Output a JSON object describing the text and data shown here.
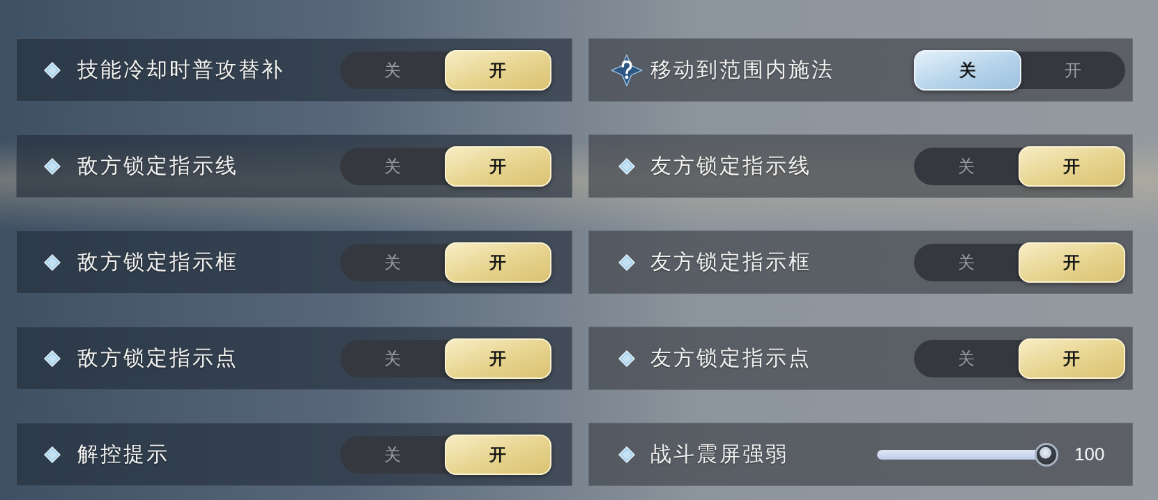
{
  "settings": [
    {
      "label": "技能冷却时普攻替补",
      "help": false,
      "kind": "toggle",
      "options": [
        {
          "label": "关",
          "selected": false
        },
        {
          "label": "开",
          "selected": true
        }
      ]
    },
    {
      "label": "移动到范围内施法",
      "help": true,
      "kind": "toggle",
      "options": [
        {
          "label": "关",
          "selected": true
        },
        {
          "label": "开",
          "selected": false
        }
      ]
    },
    {
      "label": "敌方锁定指示线",
      "help": false,
      "kind": "toggle",
      "options": [
        {
          "label": "关",
          "selected": false
        },
        {
          "label": "开",
          "selected": true
        }
      ]
    },
    {
      "label": "友方锁定指示线",
      "help": false,
      "kind": "toggle",
      "options": [
        {
          "label": "关",
          "selected": false
        },
        {
          "label": "开",
          "selected": true
        }
      ]
    },
    {
      "label": "敌方锁定指示框",
      "help": false,
      "kind": "toggle",
      "options": [
        {
          "label": "关",
          "selected": false
        },
        {
          "label": "开",
          "selected": true
        }
      ]
    },
    {
      "label": "友方锁定指示框",
      "help": false,
      "kind": "toggle",
      "options": [
        {
          "label": "关",
          "selected": false
        },
        {
          "label": "开",
          "selected": true
        }
      ]
    },
    {
      "label": "敌方锁定指示点",
      "help": false,
      "kind": "toggle",
      "options": [
        {
          "label": "关",
          "selected": false
        },
        {
          "label": "开",
          "selected": true
        }
      ]
    },
    {
      "label": "友方锁定指示点",
      "help": false,
      "kind": "toggle",
      "options": [
        {
          "label": "关",
          "selected": false
        },
        {
          "label": "开",
          "selected": true
        }
      ]
    },
    {
      "label": "解控提示",
      "help": false,
      "kind": "toggle",
      "options": [
        {
          "label": "关",
          "selected": false
        },
        {
          "label": "开",
          "selected": true
        }
      ]
    },
    {
      "label": "战斗震屏强弱",
      "help": false,
      "kind": "slider",
      "level": 1,
      "reading": "100"
    }
  ]
}
